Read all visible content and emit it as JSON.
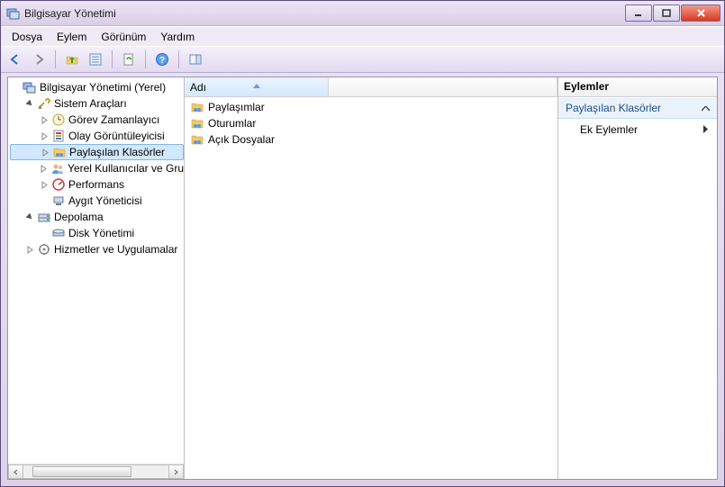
{
  "window": {
    "title": "Bilgisayar Yönetimi"
  },
  "menu": {
    "file": "Dosya",
    "action": "Eylem",
    "view": "Görünüm",
    "help": "Yardım"
  },
  "tree": {
    "root": "Bilgisayar Yönetimi (Yerel)",
    "system_tools": "Sistem Araçları",
    "task_scheduler": "Görev Zamanlayıcı",
    "event_viewer": "Olay Görüntüleyicisi",
    "shared_folders": "Paylaşılan Klasörler",
    "local_users": "Yerel Kullanıcılar ve Gru",
    "performance": "Performans",
    "device_manager": "Aygıt Yöneticisi",
    "storage": "Depolama",
    "disk_mgmt": "Disk Yönetimi",
    "services_apps": "Hizmetler ve Uygulamalar"
  },
  "list": {
    "column_name": "Adı",
    "items": {
      "shares": "Paylaşımlar",
      "sessions": "Oturumlar",
      "open_files": "Açık Dosyalar"
    }
  },
  "actions": {
    "header": "Eylemler",
    "group": "Paylaşılan Klasörler",
    "more": "Ek Eylemler"
  }
}
